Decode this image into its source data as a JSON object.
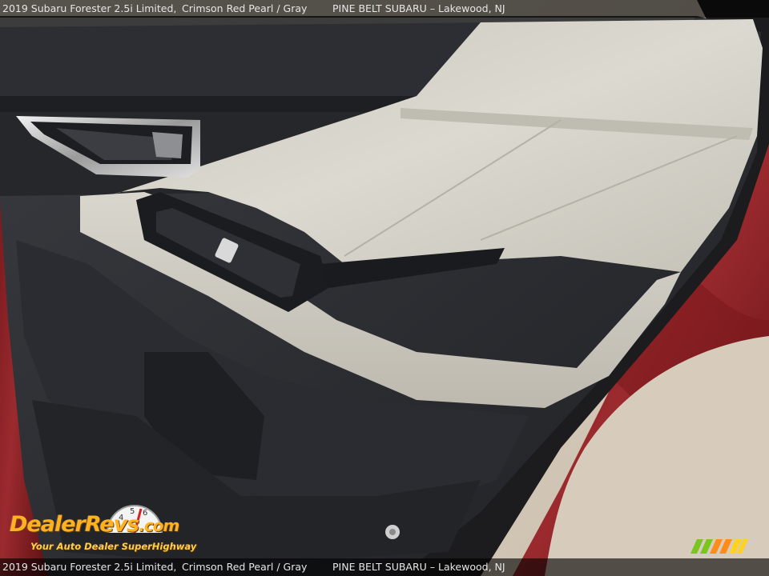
{
  "caption": {
    "vehicle": "2019 Subaru Forester 2.5i Limited,",
    "color": "Crimson Red Pearl / Gray",
    "dealer": "PINE BELT SUBARU – Lakewood, NJ"
  },
  "watermark": {
    "brand": "DealerRevs",
    "brand_suffix": ".com",
    "tagline": "Your Auto Dealer SuperHighway"
  },
  "colors": {
    "paint": "#8a1f24",
    "upholstery": "#d6d3c9",
    "trim": "#2b2d31",
    "watermark_orange": "#ffb11f"
  }
}
